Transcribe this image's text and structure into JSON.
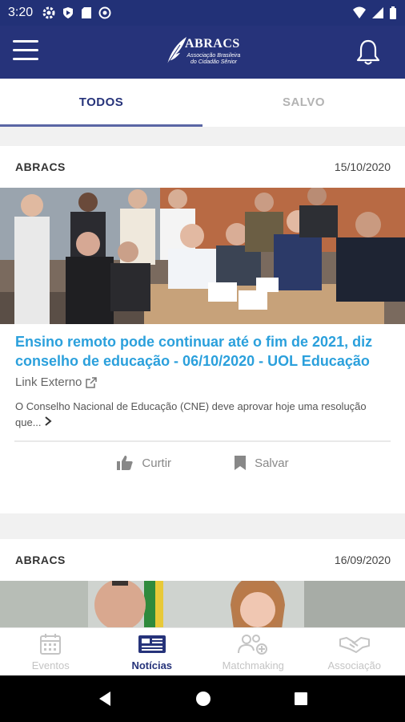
{
  "status_bar": {
    "time": "3:20",
    "icons": [
      "gear-icon",
      "shield-play-icon",
      "sd-card-icon",
      "vpn-icon"
    ],
    "right_icons": [
      "wifi-icon",
      "signal-icon",
      "battery-icon"
    ]
  },
  "header": {
    "logo_word": "ABRACS",
    "logo_subtitle": "Associação Brasileira do Cidadão Sênior"
  },
  "tabs": [
    {
      "label": "TODOS",
      "active": true
    },
    {
      "label": "SALVO",
      "active": false
    }
  ],
  "cards": [
    {
      "source": "ABRACS",
      "date": "15/10/2020",
      "title": "Ensino remoto pode continuar até o fim de 2021, diz conselho de educação - 06/10/2020 - UOL Educação",
      "link": "Link Externo",
      "excerpt": "O Conselho Nacional de Educação (CNE) deve aprovar hoje uma resolução que...",
      "like_label": "Curtir",
      "save_label": "Salvar"
    },
    {
      "source": "ABRACS",
      "date": "16/09/2020"
    }
  ],
  "bottom_nav": [
    {
      "label": "Eventos",
      "icon": "calendar-icon",
      "active": false
    },
    {
      "label": "Notícias",
      "icon": "newspaper-icon",
      "active": true
    },
    {
      "label": "Matchmaking",
      "icon": "people-add-icon",
      "active": false
    },
    {
      "label": "Associação",
      "icon": "handshake-icon",
      "active": false
    }
  ],
  "colors": {
    "primary": "#26337a",
    "title_blue": "#2ba0dc",
    "inactive": "#c4c4c4"
  }
}
